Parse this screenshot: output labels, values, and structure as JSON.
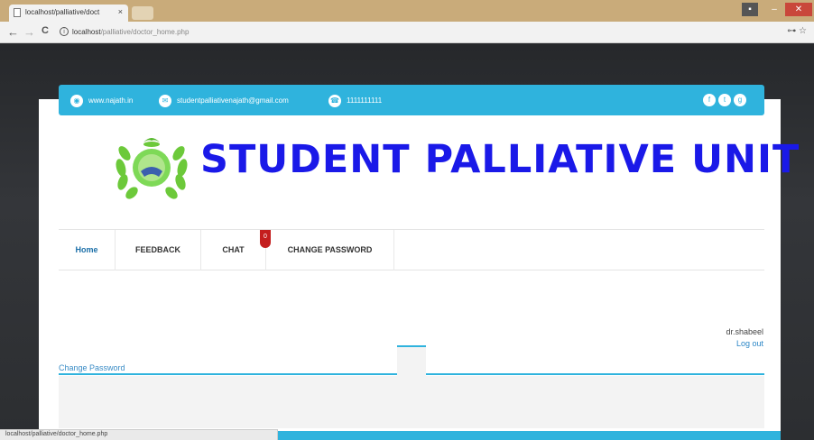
{
  "browser": {
    "tab_title": "localhost/palliative/doct",
    "tab_close": "×",
    "url_host": "localhost",
    "url_path": "/palliative/doctor_home.php",
    "status_url": "localhost/palliative/doctor_home.php",
    "back": "←",
    "forward": "→",
    "reload": "C",
    "addr_right": "⊶ ☆"
  },
  "topbar": {
    "website": "www.najath.in",
    "email": "studentpalliativenajath@gmail.com",
    "phone": "1111111111",
    "accent": "#2fb3dd"
  },
  "header": {
    "title": "STUDENT PALLIATIVE UNIT",
    "title_color": "#1a19e8"
  },
  "menu": {
    "items": [
      {
        "label": "Home"
      },
      {
        "label": "FEEDBACK"
      },
      {
        "label": "CHAT"
      },
      {
        "label": "CHANGE PASSWORD"
      }
    ],
    "chat_badge": "0"
  },
  "user": {
    "name": "dr.shabeel",
    "logout": "Log out"
  },
  "section": {
    "change_password": "Change Password"
  }
}
